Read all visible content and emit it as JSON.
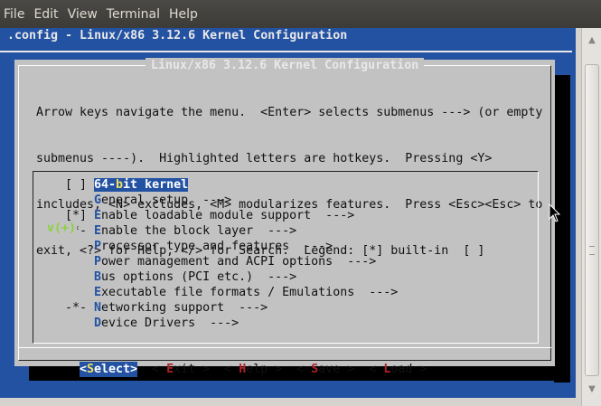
{
  "menubar": {
    "items": [
      {
        "label": "File"
      },
      {
        "label": "Edit"
      },
      {
        "label": "View"
      },
      {
        "label": "Terminal"
      },
      {
        "label": "Help"
      }
    ]
  },
  "terminal": {
    "top_line": ".config - Linux/x86 3.12.6 Kernel Configuration"
  },
  "dialog": {
    "title": "Linux/x86 3.12.6 Kernel Configuration",
    "help_lines": [
      "Arrow keys navigate the menu.  <Enter> selects submenus ---> (or empty",
      "submenus ----).  Highlighted letters are hotkeys.  Pressing <Y>",
      "includes, <N> excludes, <M> modularizes features.  Press <Esc><Esc> to",
      "exit, <?> for Help, </> for Search.  Legend: [*] built-in  [ ]"
    ],
    "menu_items": [
      {
        "mark": "[ ] ",
        "pre": "64-",
        "hotkey": "b",
        "post": "it kernel",
        "selected": true
      },
      {
        "mark": "    ",
        "pre": "",
        "hotkey": "G",
        "post": "eneral setup  --->"
      },
      {
        "mark": "[*] ",
        "pre": "",
        "hotkey": "E",
        "post": "nable loadable module support  --->"
      },
      {
        "mark": "-*- ",
        "pre": "",
        "hotkey": "E",
        "post": "nable the block layer  --->"
      },
      {
        "mark": "    ",
        "pre": "",
        "hotkey": "P",
        "post": "rocessor type and features  --->"
      },
      {
        "mark": "    ",
        "pre": "",
        "hotkey": "P",
        "post": "ower management and ACPI options  --->"
      },
      {
        "mark": "    ",
        "pre": "",
        "hotkey": "B",
        "post": "us options (PCI etc.)  --->"
      },
      {
        "mark": "    ",
        "pre": "",
        "hotkey": "E",
        "post": "xecutable file formats / Emulations  --->"
      },
      {
        "mark": "-*- ",
        "pre": "",
        "hotkey": "N",
        "post": "etworking support  --->"
      },
      {
        "mark": "    ",
        "pre": "",
        "hotkey": "D",
        "post": "evice Drivers  --->"
      }
    ],
    "more_indicator": "v(+)",
    "buttons": [
      {
        "pre": "<",
        "hotkey": "S",
        "post": "elect>",
        "selected": true
      },
      {
        "pre": "< ",
        "hotkey": "E",
        "post": "xit >"
      },
      {
        "pre": "< ",
        "hotkey": "H",
        "post": "elp >"
      },
      {
        "pre": "< ",
        "hotkey": "S",
        "post": "ave >"
      },
      {
        "pre": "< ",
        "hotkey": "L",
        "post": "oad >"
      }
    ]
  },
  "icons": {
    "scroll_up": "arrow-up-icon",
    "scroll_down": "arrow-down-icon",
    "pointer": "mouse-pointer-icon"
  },
  "colors": {
    "terminal_bg": "#2352a3",
    "dialog_bg": "#c2c2c2",
    "hotkey_menu": "#2352a3",
    "hotkey_button": "#b0202a",
    "more_indicator": "#8ad23a"
  }
}
